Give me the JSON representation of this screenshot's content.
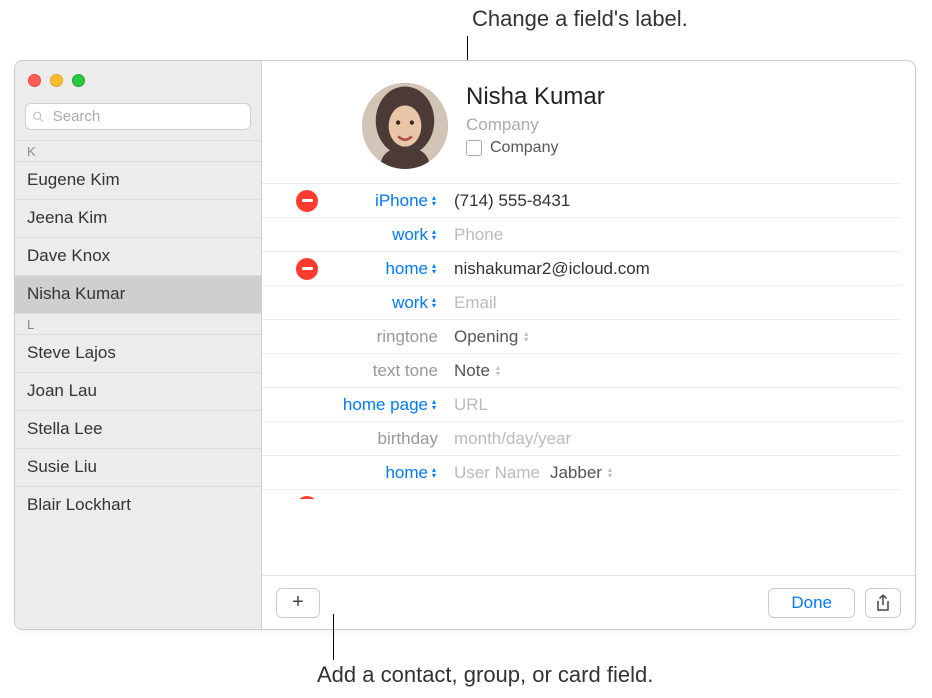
{
  "callouts": {
    "top": "Change a field's label.",
    "bottom": "Add a contact, group, or card field."
  },
  "search": {
    "placeholder": "Search"
  },
  "sections": {
    "k": "K",
    "l": "L"
  },
  "contacts": {
    "k": [
      {
        "name": "Eugene Kim"
      },
      {
        "name": "Jeena Kim"
      },
      {
        "name": "Dave Knox"
      },
      {
        "name": "Nisha Kumar",
        "selected": true
      }
    ],
    "l": [
      {
        "name": "Steve Lajos"
      },
      {
        "name": "Joan Lau"
      },
      {
        "name": "Stella Lee"
      },
      {
        "name": "Susie Liu"
      },
      {
        "name": "Blair Lockhart"
      }
    ]
  },
  "card": {
    "name": "Nisha  Kumar",
    "company_placeholder": "Company",
    "company_checkbox_label": "Company",
    "fields": [
      {
        "label": "iPhone",
        "labelStyle": "blue",
        "stepper": true,
        "delete": true,
        "value": "(714) 555-8431"
      },
      {
        "label": "work",
        "labelStyle": "blue",
        "stepper": true,
        "delete": false,
        "placeholder": "Phone"
      },
      {
        "label": "home",
        "labelStyle": "blue",
        "stepper": true,
        "delete": true,
        "value": "nishakumar2@icloud.com"
      },
      {
        "label": "work",
        "labelStyle": "blue",
        "stepper": true,
        "delete": false,
        "placeholder": "Email"
      },
      {
        "label": "ringtone",
        "labelStyle": "grey",
        "stepper": false,
        "delete": false,
        "select": "Opening"
      },
      {
        "label": "text tone",
        "labelStyle": "grey",
        "stepper": false,
        "delete": false,
        "select": "Note"
      },
      {
        "label": "home page",
        "labelStyle": "blue",
        "stepper": true,
        "delete": false,
        "placeholder": "URL"
      },
      {
        "label": "birthday",
        "labelStyle": "grey",
        "stepper": false,
        "delete": false,
        "placeholder": "month/day/year"
      },
      {
        "label": "home",
        "labelStyle": "blue",
        "stepper": true,
        "delete": false,
        "placeholder": "User Name",
        "select2": "Jabber"
      }
    ]
  },
  "footer": {
    "done": "Done",
    "add": "+"
  }
}
